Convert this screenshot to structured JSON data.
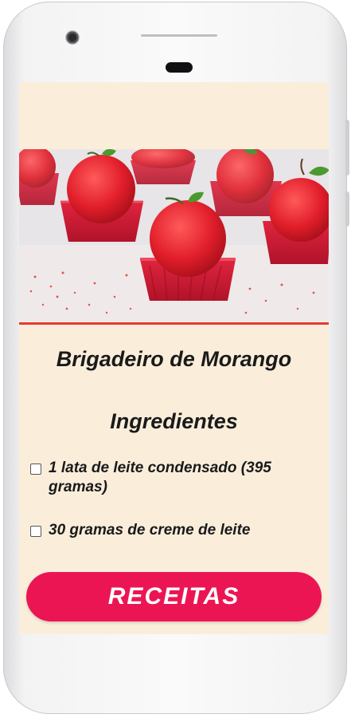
{
  "recipe": {
    "title": "Brigadeiro de Morango",
    "ingredients_heading": "Ingredientes",
    "ingredients": [
      {
        "label": "1 lata de leite condensado (395 gramas)",
        "checked": false
      },
      {
        "label": "30 gramas de creme de leite",
        "checked": false
      }
    ],
    "image_description": "strawberry brigadeiros in red paper cups"
  },
  "action_button": {
    "label": "RECEITAS",
    "color": "#ec1553"
  },
  "colors": {
    "screen_background": "#faeedb",
    "divider": "#e53935",
    "accent": "#ec1553"
  }
}
